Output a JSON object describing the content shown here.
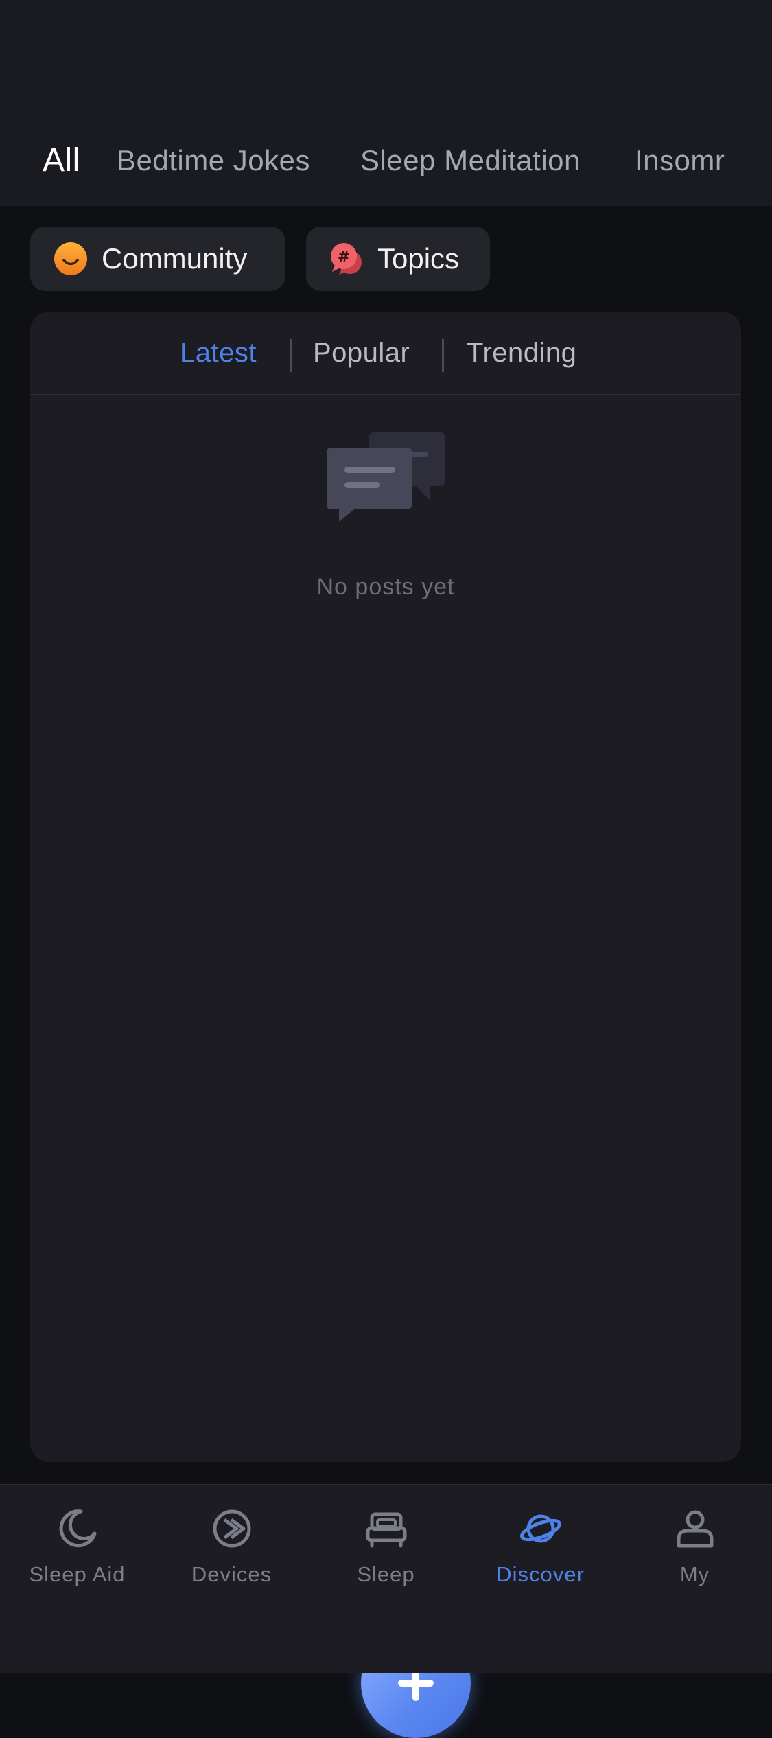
{
  "category_tabs": [
    "All",
    "Bedtime Jokes",
    "Sleep Meditation",
    "Insomr"
  ],
  "chips": {
    "community": {
      "label": "Community",
      "icon": "smiley-icon"
    },
    "topics": {
      "label": "Topics",
      "icon": "hashtag-chat-icon"
    }
  },
  "sort_tabs": [
    "Latest",
    "Popular",
    "Trending"
  ],
  "empty_state": {
    "icon": "chat-bubbles-icon",
    "text": "No posts yet"
  },
  "fab": {
    "icon": "plus-icon"
  },
  "bottom_nav": [
    {
      "label": "Sleep Aid",
      "icon": "moon-icon"
    },
    {
      "label": "Devices",
      "icon": "device-icon"
    },
    {
      "label": "Sleep",
      "icon": "bed-icon"
    },
    {
      "label": "Discover",
      "icon": "planet-icon"
    },
    {
      "label": "My",
      "icon": "person-icon"
    }
  ],
  "colors": {
    "accent": "#4f82e6",
    "background": "#0f1014",
    "panel": "#1c1c22",
    "inactive_text": "#7b7e89"
  }
}
